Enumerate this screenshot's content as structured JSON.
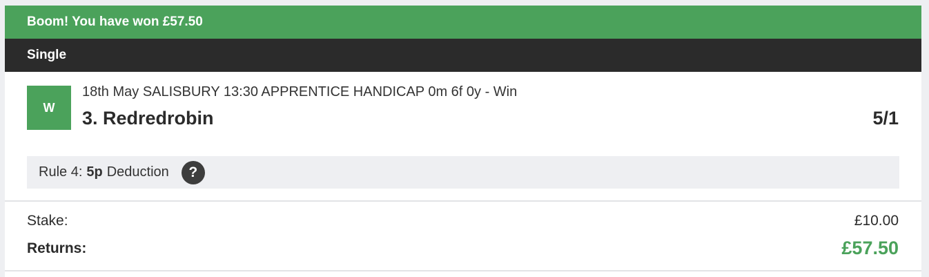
{
  "banner": {
    "text": "Boom! You have won £57.50"
  },
  "bet_type": "Single",
  "selection": {
    "result_badge": "W",
    "event": "18th May SALISBURY 13:30 APPRENTICE HANDICAP 0m 6f 0y - Win",
    "runner": "3. Redredrobin",
    "odds": "5/1",
    "rule4": {
      "prefix": "Rule 4:",
      "amount": "5p",
      "suffix": "Deduction",
      "help_glyph": "?"
    }
  },
  "summary": {
    "stake_label": "Stake:",
    "stake_value": "£10.00",
    "returns_label": "Returns:",
    "returns_value": "£57.50"
  },
  "colors": {
    "win_green": "#4ba25b",
    "header_dark": "#2b2b2b",
    "panel_grey": "#eeeff2"
  }
}
